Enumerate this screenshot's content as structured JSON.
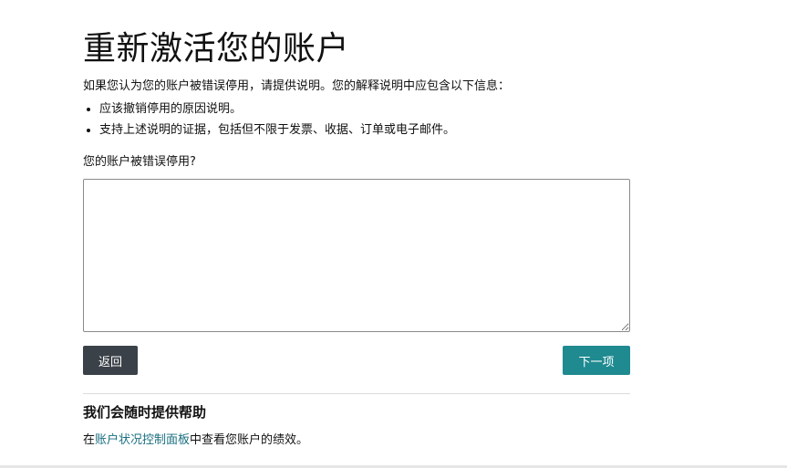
{
  "page": {
    "title": "重新激活您的账户",
    "intro": "如果您认为您的账户被错误停用，请提供说明。您的解释说明中应包含以下信息：",
    "bullets": [
      "应该撤销停用的原因说明。",
      "支持上述说明的证据，包括但不限于发票、收据、订单或电子邮件。"
    ],
    "question_label": "您的账户被错误停用?",
    "textarea_value": ""
  },
  "actions": {
    "back_label": "返回",
    "next_label": "下一项"
  },
  "help": {
    "title": "我们会随时提供帮助",
    "prefix": "在",
    "link_text": "账户状况控制面板",
    "suffix": "中查看您账户的绩效。"
  },
  "colors": {
    "back_button": "#3b4148",
    "next_button": "#1f8a90",
    "link": "#1a6f80"
  }
}
